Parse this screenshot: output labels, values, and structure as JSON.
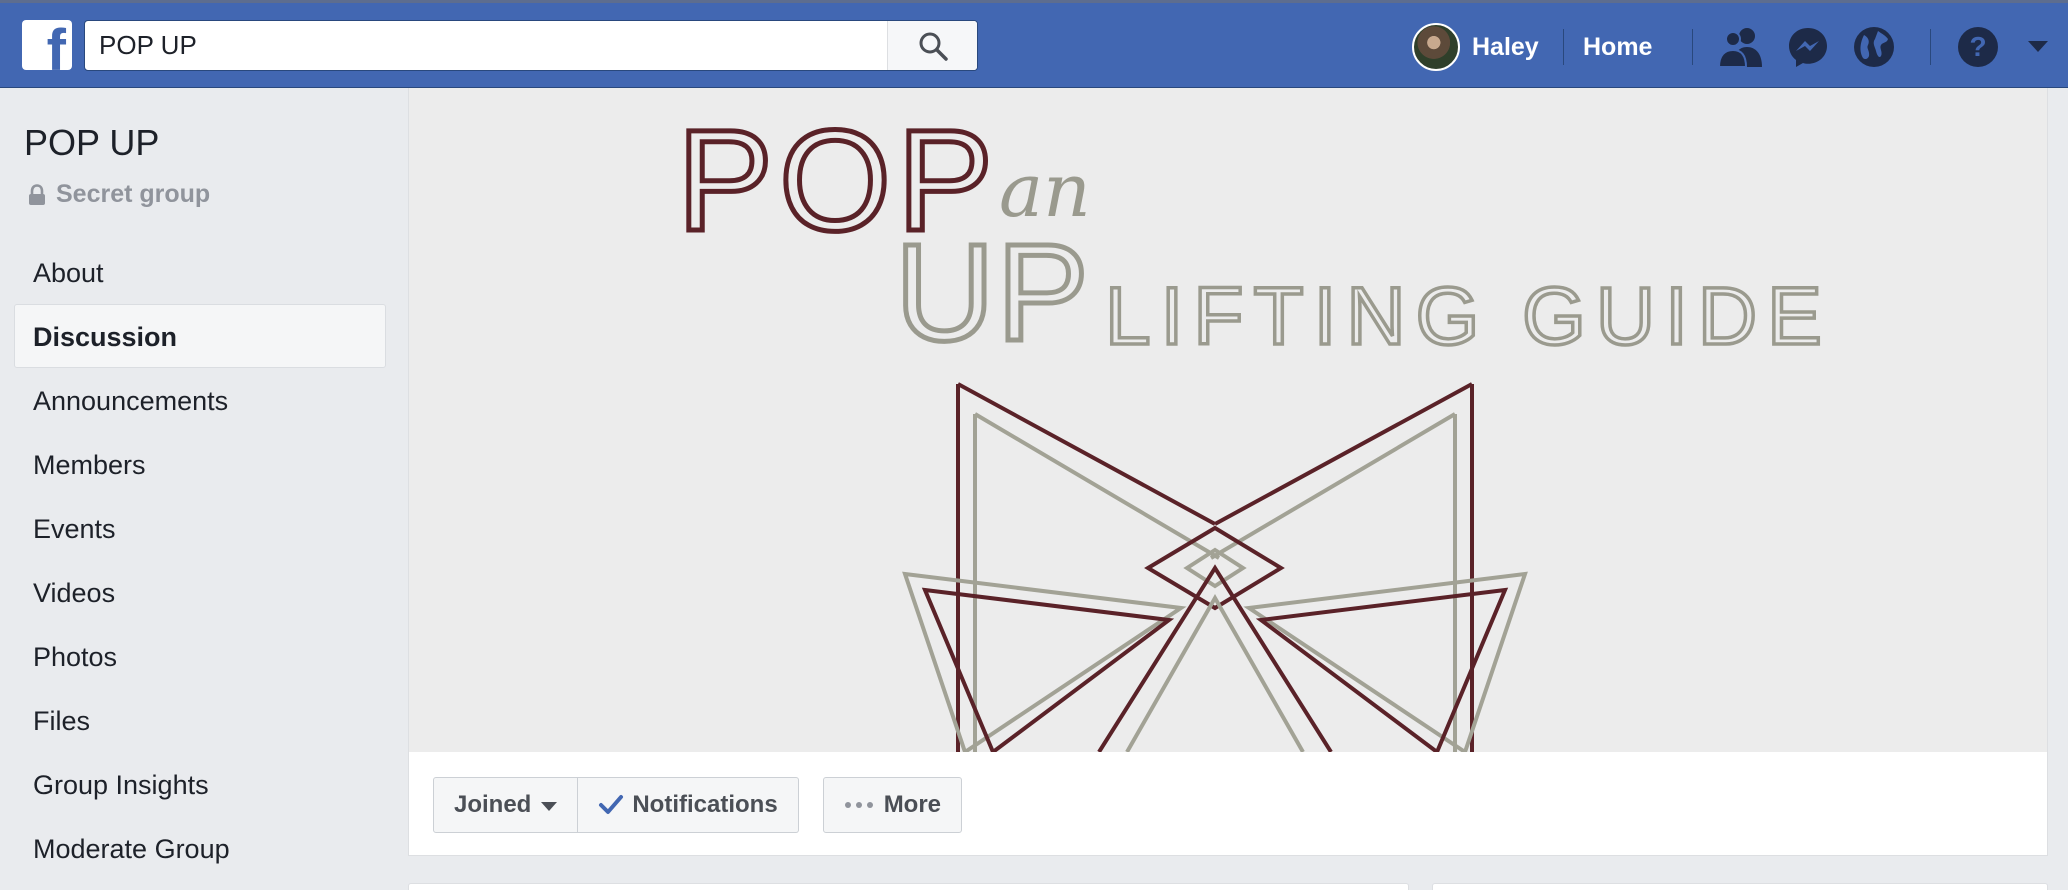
{
  "topbar": {
    "logo_letter": "f",
    "search_value": "POP UP",
    "user_name": "Haley",
    "home_label": "Home",
    "colors": {
      "bar": "#4267b2",
      "bar_border": "#29487d"
    },
    "icons": [
      "friend-requests-icon",
      "messenger-icon",
      "notifications-globe-icon",
      "help-icon",
      "account-menu-caret-icon"
    ]
  },
  "group": {
    "title": "POP UP",
    "privacy": "Secret group"
  },
  "sidebar": {
    "items": [
      {
        "label": "About"
      },
      {
        "label": "Discussion",
        "active": true
      },
      {
        "label": "Announcements"
      },
      {
        "label": "Members"
      },
      {
        "label": "Events"
      },
      {
        "label": "Videos"
      },
      {
        "label": "Photos"
      },
      {
        "label": "Files"
      },
      {
        "label": "Group Insights"
      },
      {
        "label": "Moderate Group"
      }
    ]
  },
  "cover": {
    "line1": "POP",
    "script_word": "an",
    "line2": "UP",
    "line2_rest": "LIFTING GUIDE",
    "colors": {
      "maroon": "#5a2228",
      "gray": "#9a9a8e",
      "background": "#ececec"
    }
  },
  "actions": {
    "joined_label": "Joined",
    "notifications_label": "Notifications",
    "more_label": "More"
  }
}
